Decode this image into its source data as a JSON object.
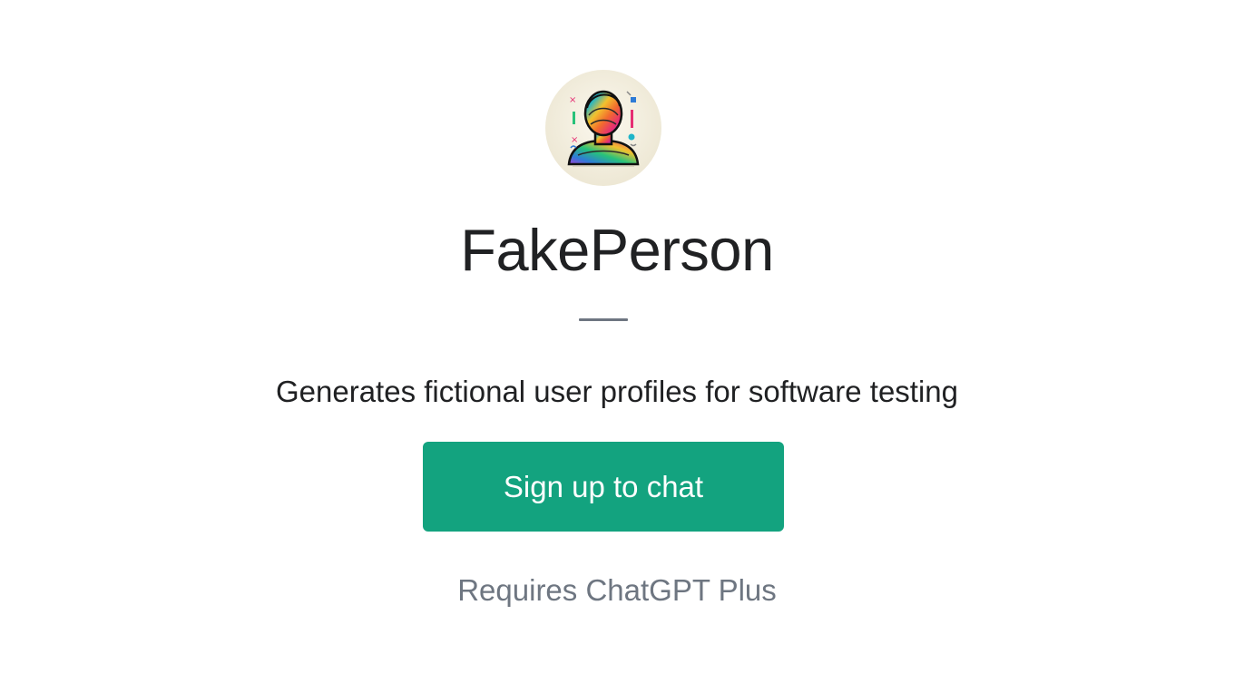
{
  "gpt": {
    "name": "FakePerson",
    "description": "Generates fictional user profiles for software testing",
    "avatar_icon": "rainbow-person-silhouette-icon"
  },
  "actions": {
    "signup_label": "Sign up to chat"
  },
  "footer": {
    "requirement": "Requires ChatGPT Plus"
  },
  "colors": {
    "primary_button": "#13a37f",
    "title_text": "#202123",
    "muted_text": "#6e7681",
    "avatar_bg": "#f3efe0"
  }
}
